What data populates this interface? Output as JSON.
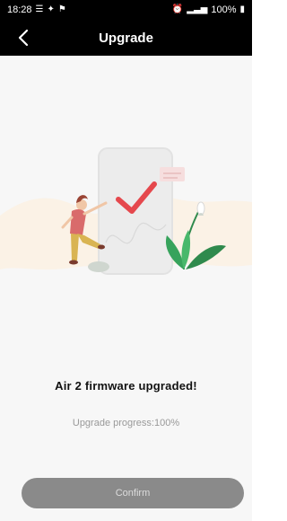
{
  "status_bar": {
    "time": "18:28",
    "battery_text": "100%"
  },
  "app_bar": {
    "title": "Upgrade",
    "back_icon": "chevron-left-icon"
  },
  "main": {
    "headline": "Air 2 firmware upgraded!",
    "progress_text": "Upgrade progress:100%",
    "progress_value": 1.0
  },
  "footer": {
    "confirm_label": "Confirm"
  },
  "colors": {
    "bar_bg": "#000000",
    "page_bg": "#f7f7f7",
    "accent_red": "#e5484d",
    "button_bg": "#8a8a8a"
  }
}
